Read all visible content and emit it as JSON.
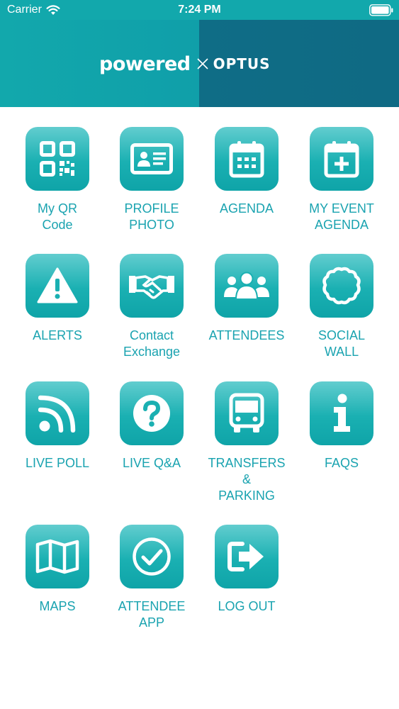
{
  "status_bar": {
    "carrier": "Carrier",
    "time": "7:24 PM",
    "wifi_icon": "wifi-icon",
    "battery_icon": "battery-full-icon"
  },
  "banner": {
    "brand_left": "powered",
    "brand_right": "OPTUS",
    "separator_icon": "cross-icon"
  },
  "colors": {
    "accent": "#12a8ac",
    "banner_dark": "#0f6d86",
    "label": "#1aa3b0"
  },
  "menu": [
    {
      "label": "My QR\nCode",
      "icon": "qr-code-icon"
    },
    {
      "label": "PROFILE\nPHOTO",
      "icon": "id-card-icon"
    },
    {
      "label": "AGENDA",
      "icon": "calendar-icon"
    },
    {
      "label": "MY EVENT\nAGENDA",
      "icon": "calendar-plus-icon"
    },
    {
      "label": "ALERTS",
      "icon": "warning-icon"
    },
    {
      "label": "Contact\nExchange",
      "icon": "handshake-icon"
    },
    {
      "label": "ATTENDEES",
      "icon": "users-icon"
    },
    {
      "label": "SOCIAL\nWALL",
      "icon": "cloud-badge-icon"
    },
    {
      "label": "LIVE POLL",
      "icon": "rss-icon"
    },
    {
      "label": "LIVE Q&A",
      "icon": "question-icon"
    },
    {
      "label": "TRANSFERS\n&\nPARKING",
      "icon": "bus-icon"
    },
    {
      "label": "FAQS",
      "icon": "info-icon"
    },
    {
      "label": "MAPS",
      "icon": "map-icon"
    },
    {
      "label": "ATTENDEE\nAPP",
      "icon": "check-circle-icon"
    },
    {
      "label": "LOG OUT",
      "icon": "logout-arrow-icon"
    }
  ]
}
